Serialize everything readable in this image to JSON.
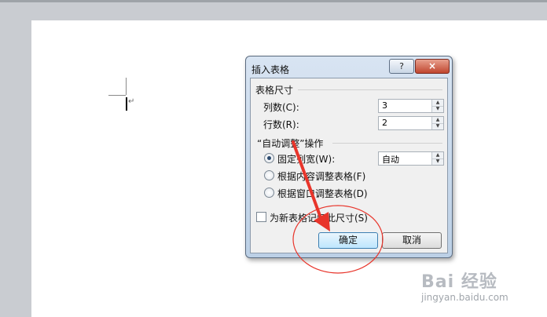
{
  "dialog": {
    "title": "插入表格",
    "help_label": "?",
    "close_label": "×",
    "size_group": "表格尺寸",
    "cols_label": "列数(C):",
    "cols_value": "3",
    "rows_label": "行数(R):",
    "rows_value": "2",
    "autofit_group": "“自动调整”操作",
    "fixed_label": "固定列宽(W):",
    "fixed_value": "自动",
    "content_label": "根据内容调整表格(F)",
    "window_label": "根据窗口调整表格(D)",
    "remember_label": "为新表格记忆此尺寸(S)",
    "ok_label": "确定",
    "cancel_label": "取消",
    "selected_option": "fixed",
    "remember_checked": false
  },
  "document": {
    "para_mark": "↵"
  },
  "annotation": {
    "color": "#e8352b"
  },
  "watermark": {
    "brand": "Bai 经验",
    "url": "jingyan.baidu.com"
  }
}
